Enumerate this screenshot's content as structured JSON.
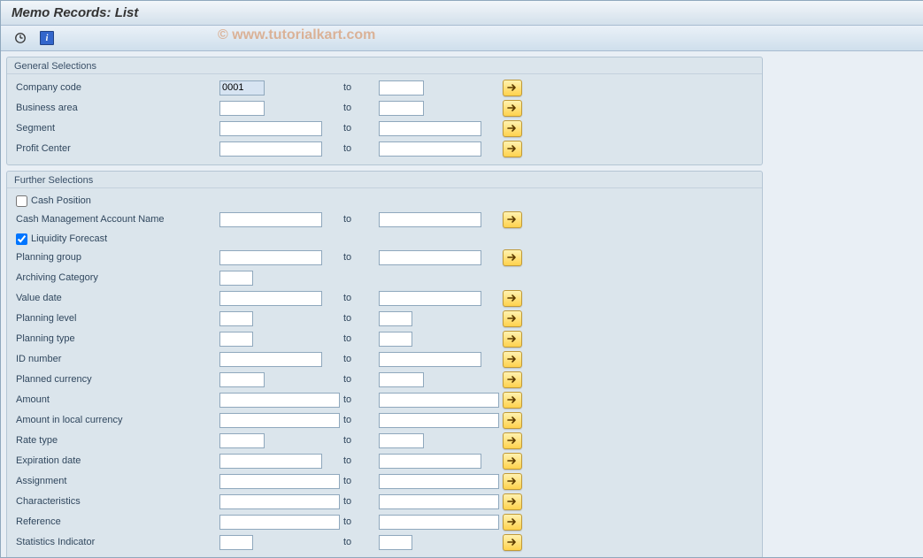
{
  "title": "Memo Records: List",
  "watermark": "© www.tutorialkart.com",
  "toolbar": {
    "execute": "Execute",
    "info": "i"
  },
  "labels": {
    "to": "to"
  },
  "groups": {
    "general": {
      "title": "General Selections",
      "rows": [
        {
          "label": "Company code",
          "from": "0001",
          "fromW": "w-s1",
          "to": "",
          "toW": "w-s1",
          "multi": true,
          "highlight": true
        },
        {
          "label": "Business area",
          "from": "",
          "fromW": "w-s1",
          "to": "",
          "toW": "w-s1",
          "multi": true
        },
        {
          "label": "Segment",
          "from": "",
          "fromW": "w-md",
          "to": "",
          "toW": "w-md",
          "multi": true
        },
        {
          "label": "Profit Center",
          "from": "",
          "fromW": "w-md",
          "to": "",
          "toW": "w-md",
          "multi": true
        }
      ]
    },
    "further": {
      "title": "Further Selections",
      "cashPosition": {
        "checked": false,
        "label": "Cash Position"
      },
      "cmAcct": {
        "label": "Cash Management Account Name",
        "from": "",
        "fromW": "w-md",
        "to": "",
        "toW": "w-md",
        "multi": true
      },
      "liquidity": {
        "checked": true,
        "label": "Liquidity Forecast"
      },
      "rows": [
        {
          "label": "Planning group",
          "from": "",
          "fromW": "w-md",
          "to": "",
          "toW": "w-md",
          "multi": true
        },
        {
          "label": "Archiving Category",
          "from": "",
          "fromW": "w-xs",
          "noTo": true
        },
        {
          "label": "Value date",
          "from": "",
          "fromW": "w-md",
          "to": "",
          "toW": "w-md",
          "multi": true
        },
        {
          "label": "Planning level",
          "from": "",
          "fromW": "w-xs",
          "to": "",
          "toW": "w-xs",
          "multi": true
        },
        {
          "label": "Planning type",
          "from": "",
          "fromW": "w-xs",
          "to": "",
          "toW": "w-xs",
          "multi": true
        },
        {
          "label": "ID number",
          "from": "",
          "fromW": "w-md",
          "to": "",
          "toW": "w-md",
          "multi": true
        },
        {
          "label": "Planned currency",
          "from": "",
          "fromW": "w-s1",
          "to": "",
          "toW": "w-s1",
          "multi": true
        },
        {
          "label": "Amount",
          "from": "",
          "fromW": "w-lg",
          "to": "",
          "toW": "w-lg",
          "multi": true
        },
        {
          "label": "Amount in local currency",
          "from": "",
          "fromW": "w-lg",
          "to": "",
          "toW": "w-lg",
          "multi": true
        },
        {
          "label": "Rate type",
          "from": "",
          "fromW": "w-s1",
          "to": "",
          "toW": "w-s1",
          "multi": true
        },
        {
          "label": "Expiration date",
          "from": "",
          "fromW": "w-md",
          "to": "",
          "toW": "w-md",
          "multi": true
        },
        {
          "label": "Assignment",
          "from": "",
          "fromW": "w-lg",
          "to": "",
          "toW": "w-lg",
          "multi": true
        },
        {
          "label": "Characteristics",
          "from": "",
          "fromW": "w-lg",
          "to": "",
          "toW": "w-lg",
          "multi": true
        },
        {
          "label": "Reference",
          "from": "",
          "fromW": "w-lg",
          "to": "",
          "toW": "w-lg",
          "multi": true
        },
        {
          "label": "Statistics Indicator",
          "from": "",
          "fromW": "w-xs",
          "to": "",
          "toW": "w-xs",
          "multi": true
        }
      ]
    }
  }
}
